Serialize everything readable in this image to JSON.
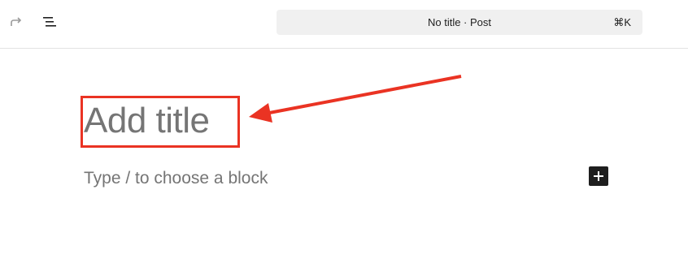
{
  "toolbar": {
    "redo_icon": "redo-icon",
    "list_view_icon": "list-view-icon"
  },
  "command_bar": {
    "title": "No title · Post",
    "shortcut": "⌘K"
  },
  "editor": {
    "title_placeholder": "Add title",
    "block_placeholder": "Type / to choose a block",
    "add_block_icon": "plus-icon"
  },
  "annotation": {
    "color": "#ea3323"
  }
}
